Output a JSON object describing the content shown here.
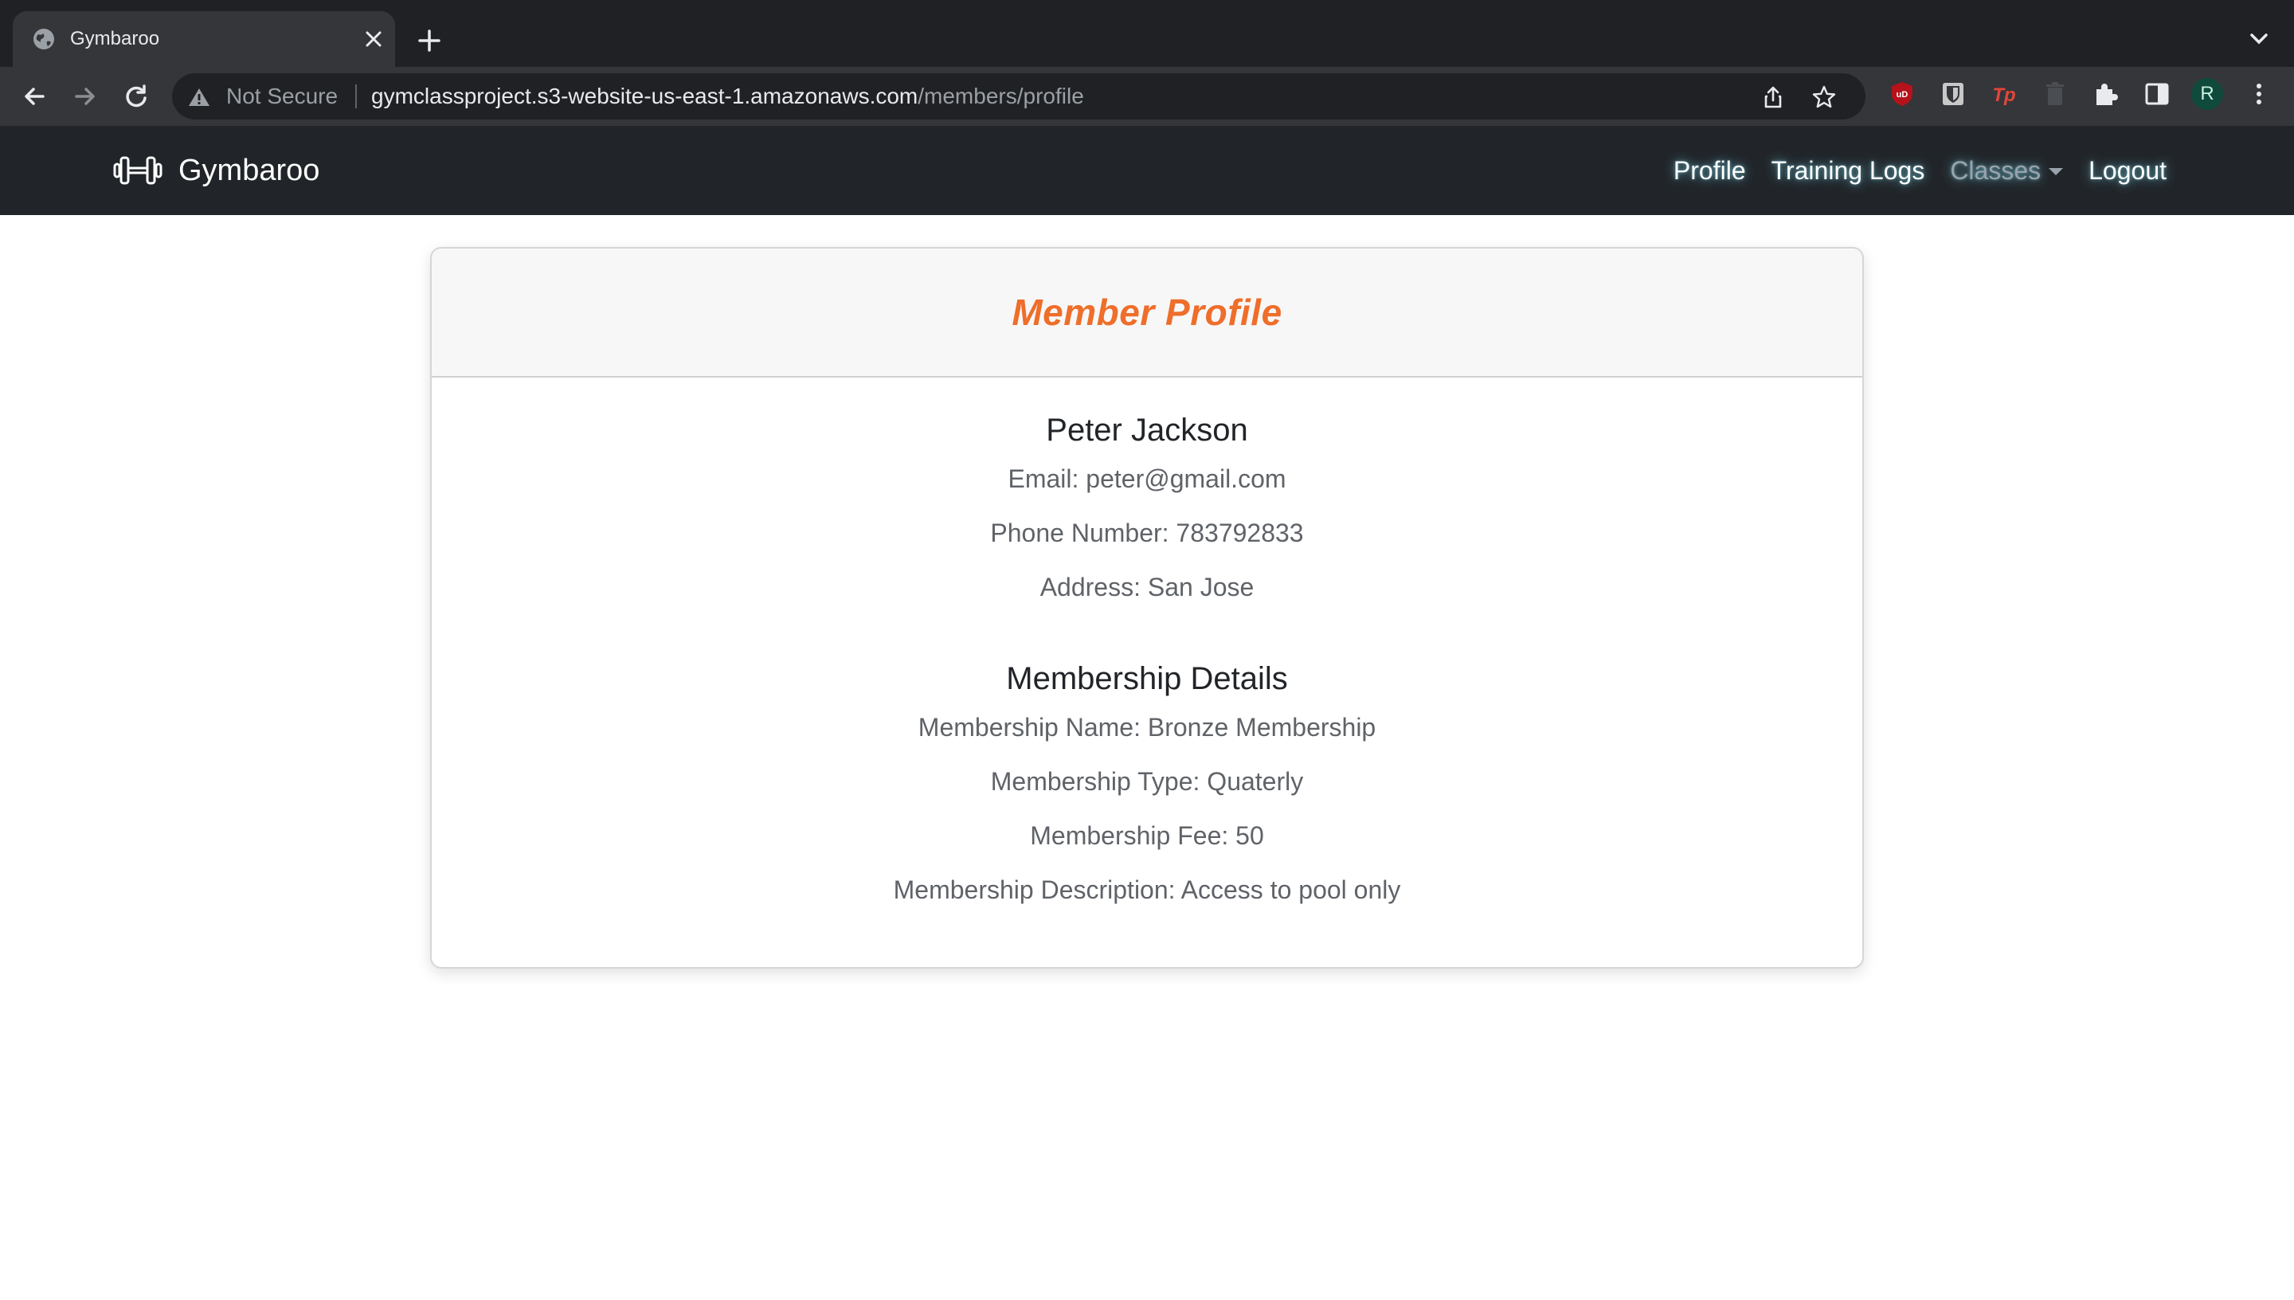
{
  "browser": {
    "tab_title": "Gymbaroo",
    "security_label": "Not Secure",
    "url_host": "gymclassproject.s3-website-us-east-1.amazonaws.com",
    "url_path": "/members/profile",
    "profile_initial": "R"
  },
  "navbar": {
    "brand": "Gymbaroo",
    "links": {
      "profile": "Profile",
      "training_logs": "Training Logs",
      "classes": "Classes",
      "logout": "Logout"
    }
  },
  "profile": {
    "heading": "Member Profile",
    "name": "Peter Jackson",
    "email": "Email: peter@gmail.com",
    "phone": "Phone Number: 783792833",
    "address": "Address: San Jose"
  },
  "membership": {
    "heading": "Membership Details",
    "name": "Membership Name: Bronze Membership",
    "type": "Membership Type: Quaterly",
    "fee": "Membership Fee: 50",
    "description": "Membership Description: Access to pool only"
  },
  "colors": {
    "accent": "#ee6e2a",
    "navbar_bg": "#212529"
  }
}
